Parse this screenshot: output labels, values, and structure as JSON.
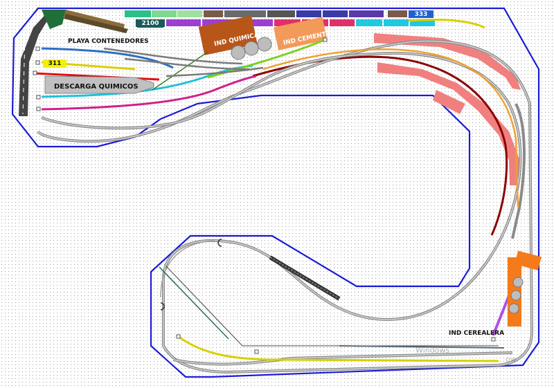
{
  "labels": {
    "playa_contenedores": "PLAYA CONTENEDORES",
    "descarga_quimicos": "DESCARGA QUIMICOS",
    "ind_quimica": "IND QUIMICA",
    "ind_cemento": "IND CEMENT",
    "ind_cerealera": "IND CEREALERA"
  },
  "tags": {
    "loco_311": "311",
    "loco_2100": "2100",
    "loco_333": "333"
  },
  "watermark": {
    "line1": "Windows",
    "line2": "ow"
  },
  "colors": {
    "boundary": "#1b1bd6",
    "rail": "#8a8a8a",
    "industry_orange": "#c8621b",
    "platform_pink": "#f08080",
    "track_yellow": "#d8d000",
    "track_blue": "#2d6fc4",
    "track_red": "#e01010",
    "track_cyan": "#20c0d8",
    "track_magenta": "#d0208a",
    "track_green": "#80d020",
    "track_darkred": "#8b0000",
    "track_orange": "#f0a030",
    "track_purple": "#b050e0"
  }
}
